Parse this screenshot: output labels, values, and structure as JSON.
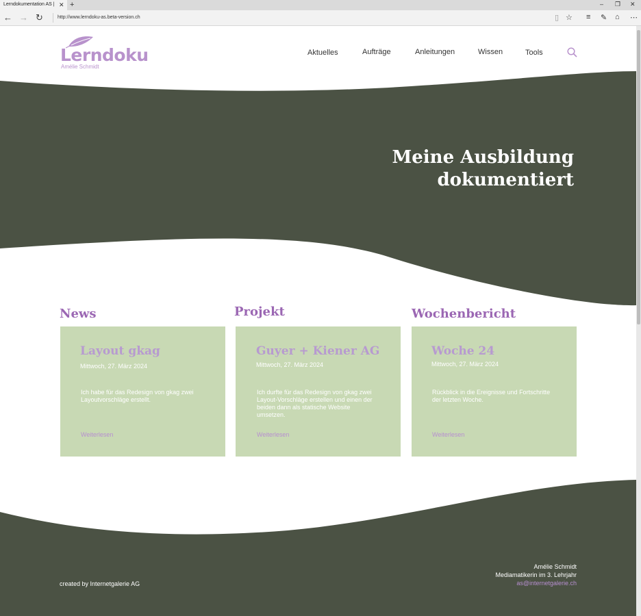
{
  "browser": {
    "tab_title": "Lerndokumentation AS |",
    "url": "http://www.lerndoku-as.beta-version.ch"
  },
  "header": {
    "logo_text": "Lerndoku",
    "logo_subtitle": "Amélie Schmidt",
    "nav": [
      "Aktuelles",
      "Aufträge",
      "Anleitungen",
      "Wissen",
      "Tools"
    ]
  },
  "hero": {
    "line1": "Meine Ausbildung",
    "line2": "dokumentiert"
  },
  "columns": [
    {
      "heading": "News",
      "card_title": "Layout gkag",
      "date": "Mittwoch, 27. März 2024",
      "text": "Ich habe für das Redesign von gkag zwei Layoutvorschläge erstellt.",
      "link": "Weiterlesen"
    },
    {
      "heading": "Projekt",
      "card_title": "Guyer + Kiener AG",
      "date": "Mittwoch, 27. März 2024",
      "text": "Ich durfte für das Redesign von gkag zwei Layout-Vorschläge erstellen und einen der beiden dann als statische Website umsetzen.",
      "link": "Weiterlesen"
    },
    {
      "heading": "Wochenbericht",
      "card_title": "Woche 24",
      "date": "Mittwoch, 27. März 2024",
      "text": "Rückblick in die Ereignisse und Fortschritte der letzten Woche.",
      "link": "Weiterlesen"
    }
  ],
  "footer": {
    "credit": "created by Internetgalerie AG",
    "name": "Amélie Schmidt",
    "role": "Mediamatikerin im 3. Lehrjahr",
    "email": "as@internetgalerie.ch"
  },
  "colors": {
    "dark_green": "#4b5244",
    "card_green": "#c8d9b4",
    "lavender": "#b892cc",
    "heading_purple": "#9b67b3"
  }
}
